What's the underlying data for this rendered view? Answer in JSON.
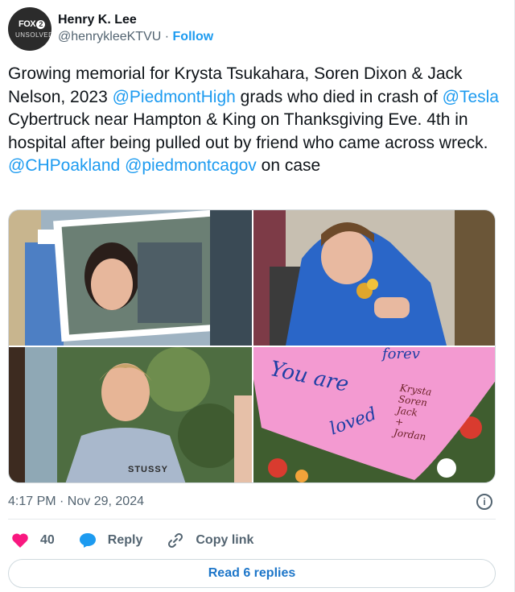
{
  "user": {
    "display_name": "Henry K. Lee",
    "handle": "@henrykleeKTVU",
    "separator": " · ",
    "follow_label": "Follow",
    "avatar_logo_top": "FOX",
    "avatar_logo_num": "2",
    "avatar_logo_bottom": "UNSOLVED"
  },
  "tweet": {
    "seg1": "Growing memorial for Krysta Tsukahara, Soren Dixon & Jack Nelson, 2023 ",
    "mention1": "@PiedmontHigh",
    "seg2": " grads who died in crash of ",
    "mention2": "@Tesla",
    "seg3": " Cybertruck near Hampton & King on Thanksgiving Eve. 4th in hospital after being pulled out by friend who came across wreck. ",
    "mention3": "@CHPoakland",
    "seg4": " ",
    "mention4": "@piedmontcagov",
    "seg5": " on case"
  },
  "media": {
    "shirt_text": "STUSSY",
    "note_line1": "You are",
    "note_line2": "loved",
    "note_top": "forev",
    "note_names": [
      "Krysta",
      "Soren",
      "Jack",
      "+",
      "Jordan"
    ]
  },
  "meta": {
    "timestamp": "4:17 PM · Nov 29, 2024",
    "info_glyph": "i"
  },
  "actions": {
    "like_count": "40",
    "reply_label": "Reply",
    "copy_label": "Copy link"
  },
  "replies_button": "Read 6 replies",
  "colors": {
    "accent": "#1d9bf0",
    "like": "#f91880",
    "reply_icon": "#1d9bf0"
  }
}
